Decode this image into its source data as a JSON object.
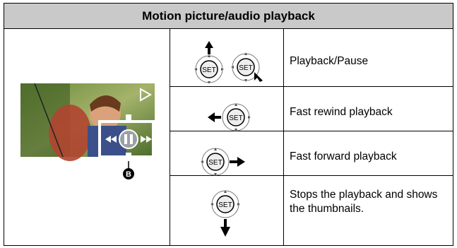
{
  "header": {
    "title": "Motion picture/audio playback"
  },
  "preview": {
    "callout": "B",
    "description": "Playback screen with control icons"
  },
  "rows": [
    {
      "label": "Playback/Pause",
      "icon": "set-button-up-and-touch"
    },
    {
      "label": "Fast rewind playback",
      "icon": "set-button-left"
    },
    {
      "label": "Fast forward playback",
      "icon": "set-button-right"
    },
    {
      "label": "Stops the playback and shows the thumbnails.",
      "icon": "set-button-down"
    }
  ]
}
